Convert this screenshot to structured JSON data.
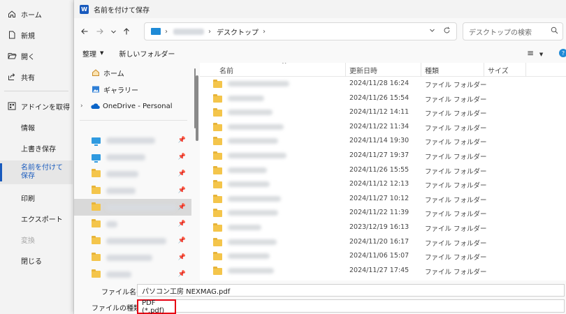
{
  "backstage": {
    "items": [
      {
        "label": "ホーム",
        "icon": "home-icon"
      },
      {
        "label": "新規",
        "icon": "new-doc-icon"
      },
      {
        "label": "開く",
        "icon": "folder-open-icon"
      },
      {
        "label": "共有",
        "icon": "share-icon"
      },
      {
        "label": "アドインを取得",
        "icon": "addins-icon"
      },
      {
        "label": "情報"
      },
      {
        "label": "上書き保存"
      },
      {
        "label": "名前を付けて保存"
      },
      {
        "label": "印刷"
      },
      {
        "label": "エクスポート"
      },
      {
        "label": "変換"
      },
      {
        "label": "閉じる"
      }
    ],
    "active": "名前を付けて保存",
    "disabled": [
      "変換"
    ]
  },
  "dialog": {
    "title": "名前を付けて保存",
    "app_icon": "W",
    "address": {
      "separator": "›",
      "current": "デスクトップ"
    },
    "search_placeholder": "デスクトップの検索",
    "toolbar": {
      "organize": "整理",
      "new_folder": "新しいフォルダー"
    },
    "nav": {
      "home": "ホーム",
      "gallery": "ギャラリー",
      "onedrive": "OneDrive - Personal"
    },
    "columns": {
      "name": "名前",
      "date": "更新日時",
      "type": "種類",
      "size": "サイズ"
    },
    "rows": [
      {
        "date": "2024/11/28 16:24",
        "type": "ファイル フォルダー"
      },
      {
        "date": "2024/11/26 15:54",
        "type": "ファイル フォルダー"
      },
      {
        "date": "2024/11/12 14:11",
        "type": "ファイル フォルダー"
      },
      {
        "date": "2024/11/22 11:34",
        "type": "ファイル フォルダー"
      },
      {
        "date": "2024/11/14 19:30",
        "type": "ファイル フォルダー"
      },
      {
        "date": "2024/11/27 19:37",
        "type": "ファイル フォルダー"
      },
      {
        "date": "2024/11/26 15:55",
        "type": "ファイル フォルダー"
      },
      {
        "date": "2024/11/12 12:13",
        "type": "ファイル フォルダー"
      },
      {
        "date": "2024/11/27 10:12",
        "type": "ファイル フォルダー"
      },
      {
        "date": "2024/11/22 11:39",
        "type": "ファイル フォルダー"
      },
      {
        "date": "2023/12/19 16:13",
        "type": "ファイル フォルダー"
      },
      {
        "date": "2024/11/20 16:17",
        "type": "ファイル フォルダー"
      },
      {
        "date": "2024/11/06 15:07",
        "type": "ファイル フォルダー"
      },
      {
        "date": "2024/11/27 17:45",
        "type": "ファイル フォルダー"
      }
    ],
    "filename_label": "ファイル名(N):",
    "filename_value": "パソコン工房 NEXMAG.pdf",
    "filetype_label": "ファイルの種類(T):",
    "filetype_value": "PDF (*.pdf)"
  },
  "colors": {
    "accent": "#185abd",
    "highlight": "#e60012",
    "folder": "#f4c54b"
  }
}
